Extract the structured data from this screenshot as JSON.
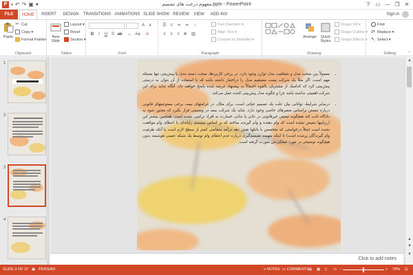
{
  "window": {
    "title": "مفهوم درخت های تصمیم.pptx - PowerPoint",
    "app_icon": "P",
    "controls": [
      "?",
      "▭",
      "—",
      "❐",
      "✕"
    ]
  },
  "tabs": [
    {
      "label": "FILE"
    },
    {
      "label": "HOME"
    },
    {
      "label": "INSERT"
    },
    {
      "label": "DESIGN"
    },
    {
      "label": "TRANSITIONS"
    },
    {
      "label": "ANIMATIONS"
    },
    {
      "label": "SLIDE SHOW"
    },
    {
      "label": "REVIEW"
    },
    {
      "label": "VIEW"
    },
    {
      "label": "ADD-INS"
    }
  ],
  "signin": "Sign in",
  "ribbon": {
    "clipboard": {
      "label": "Clipboard",
      "paste": "Paste",
      "cut": "Cut",
      "copy": "Copy",
      "format_painter": "Format Painter"
    },
    "slides": {
      "label": "Slides",
      "new_slide": "New Slide",
      "layout": "Layout",
      "reset": "Reset",
      "section": "Section"
    },
    "font": {
      "label": "Font"
    },
    "paragraph": {
      "label": "Paragraph",
      "text_direction": "Text Direction",
      "align_text": "Align Text",
      "convert_smartart": "Convert to SmartArt"
    },
    "drawing": {
      "label": "Drawing",
      "arrange": "Arrange",
      "quick_styles": "Quick Styles",
      "shape_fill": "Shape Fill",
      "shape_outline": "Shape Outline",
      "shape_effects": "Shape Effects"
    },
    "editing": {
      "label": "Editing",
      "find": "Find",
      "replace": "Replace",
      "select": "Select"
    }
  },
  "thumbnails": [
    {
      "num": "1"
    },
    {
      "num": "2"
    },
    {
      "num": "3"
    },
    {
      "num": "4"
    }
  ],
  "slide": {
    "bullets": [
      "معمولاً بین صحت مدل و شفافیت مدل توازن وجود دارد. در برخی کاربردها، صحت دسته بندی یا پیش‌بینی تنها مسئله مهم است. اگر مثلاً یک شرکت پست مستقیم مدل را دراختیار داشته باشد که با استفاده از آن بتوان به درستی پیش‌بینی کرد که کدامیک از مشتریان بالقوه احتمالاً به پیشنهاد عرضه شده پاسخ خواهند داد، آنگاه شاید برای این شرکت اهمیتی نداشته باشد چرا و چگونه مدل پیش‌بینی کننده عمل می‌کند.",
      "درسایر شرایط، توانایی بیان علت یک تصمیم حیاتی است. برای مثال، در غرامتهای بیمه، برخی ممنوعیتهای قانونی درباره تبعیض براساس متغیرهای خاصی وجود دارد. شاید یک شرکت بیمه در وضعیتی قرار بگیرد که مجبور شود به دادگاه ثابت کند هیچگونه تبعیض غیرقانونی در دادن یا ندادن خسارت به افراد ترکیبی نشده است. همچنین بیشتر این ارزیابیها تبعیض نشده است که وام دهنده و وام گیرنده ساخته که بر اساس سیستم رایانه‌ای با اعطای وام موافقت نشده است (مثلاً درخواستی که متخصص با بانکها نقش دهد درآمد متقاضی کمتر از سطح لازم است یا آنکه ظرفیت وام گیرندگان پرشده است) تا اینکه بفهمند تصمیم‌گیری درباره عدم اعطای وام توسط یک شبکه عصبی هوشمند بدون هیچگونه توضیحی در مورد عملکردش صورت گرفته است."
    ]
  },
  "notes_placeholder": "Click to add notes",
  "status": {
    "slide_info": "SLIDE 3 OF 37",
    "language": "PERSIAN",
    "notes": "NOTES",
    "comments": "COMMENTS",
    "zoom": "70%"
  },
  "colors": {
    "accent": "#d24726",
    "ribbon_bg": "#ffffff",
    "panel_bg": "#e9e9e9"
  }
}
